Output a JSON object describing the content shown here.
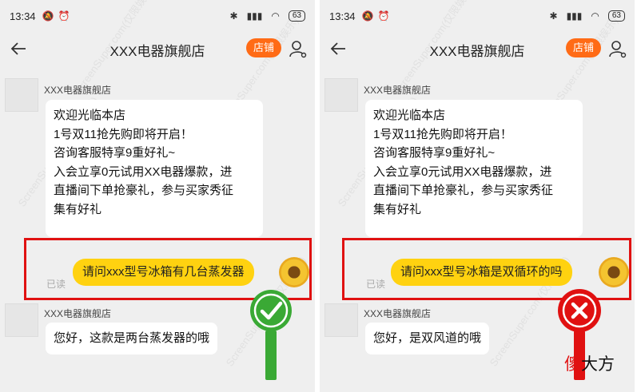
{
  "left": {
    "status": {
      "time": "13:34",
      "battery": "63"
    },
    "nav": {
      "title": "XXX电器旗舰店",
      "store_btn": "店铺"
    },
    "msg1": {
      "sender": "XXX电器旗舰店",
      "lines": [
        "欢迎光临本店",
        "1号双11抢先购即将开启！",
        "咨询客服特享9重好礼~",
        "入会立享0元试用XX电器爆款，进",
        "直播间下单抢豪礼，参与买家秀征",
        "集有好礼"
      ]
    },
    "my_msg": {
      "text": "请问xxx型号冰箱有几台蒸发器",
      "read": "已读"
    },
    "msg2": {
      "sender": "XXX电器旗舰店",
      "text": "您好，这款是两台蒸发器的哦"
    }
  },
  "right": {
    "status": {
      "time": "13:34",
      "battery": "63"
    },
    "nav": {
      "title": "XXX电器旗舰店",
      "store_btn": "店铺"
    },
    "msg1": {
      "sender": "XXX电器旗舰店",
      "lines": [
        "欢迎光临本店",
        "1号双11抢先购即将开启！",
        "咨询客服特享9重好礼~",
        "入会立享0元试用XX电器爆款，进",
        "直播间下单抢豪礼，参与买家秀征",
        "集有好礼"
      ]
    },
    "my_msg": {
      "text": "请问xxx型号冰箱是双循环的吗",
      "read": "已读"
    },
    "msg2": {
      "sender": "XXX电器旗舰店",
      "text": "您好，是双风道的哦"
    }
  },
  "watermark": "ScreenSuper.com(仅限娱乐)",
  "logo": {
    "first": "傻",
    "rest": "大方"
  },
  "colors": {
    "accent": "#ff6b16",
    "my_bubble": "#ffd210",
    "highlight": "#e01111",
    "check": "#3aa935",
    "cross": "#e01111"
  }
}
